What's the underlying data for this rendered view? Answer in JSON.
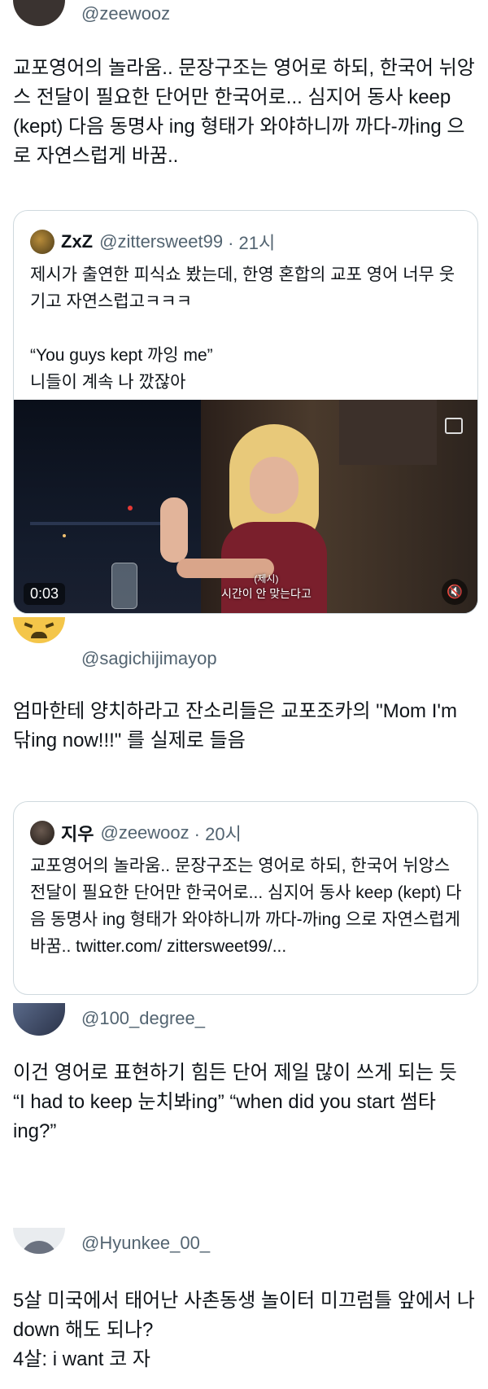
{
  "tweets": [
    {
      "handle": "@zeewooz",
      "text": "교포영어의 놀라움.. 문장구조는 영어로 하되, 한국어 뉘앙스 전달이 필요한 단어만 한국어로... 심지어 동사 keep (kept) 다음 동명사 ing 형태가 와야하니까 까다-까ing 으로 자연스럽게 바꿈..",
      "quote": {
        "name": "ZxZ",
        "handle": "@zittersweet99",
        "time": "· 21시",
        "text": "제시가 출연한 피식쇼 봤는데, 한영 혼합의 교포 영어 너무 웃기고 자연스럽고ㅋㅋㅋ\n\n“You guys kept 까잉 me”\n니들이 계속 나 깠잖아",
        "video": {
          "time": "0:03",
          "subtitle": "시간이 안 맞는다고",
          "subtitle_top": "(제시)"
        }
      }
    },
    {
      "handle": "@sagichijimayop",
      "text": "엄마한테 양치하라고 잔소리들은 교포조카의 \"Mom I'm 닦ing now!!!\" 를 실제로 들음",
      "quote": {
        "name": "지우",
        "handle": "@zeewooz",
        "time": "· 20시",
        "text": "교포영어의 놀라움.. 문장구조는 영어로 하되, 한국어 뉘앙스 전달이 필요한 단어만 한국어로... 심지어 동사 keep (kept) 다음 동명사 ing 형태가 와야하니까 까다-까ing 으로 자연스럽게 바꿈.. twitter.com/ zittersweet99/..."
      }
    },
    {
      "handle": "@100_degree_",
      "text": "이건 영어로 표현하기 힘든 단어 제일 많이 쓰게 되는 듯\n“I had to keep 눈치봐ing” “when did you start 썸타ing?”"
    },
    {
      "handle": "@Hyunkee_00_",
      "text": "5살 미국에서 태어난 사촌동생 놀이터 미끄럼틀 앞에서 나 down 해도 되나?\n4살: i want 코 자"
    }
  ],
  "colors": {
    "text": "#0f1419",
    "secondary": "#536471",
    "border": "#cfd9de"
  }
}
